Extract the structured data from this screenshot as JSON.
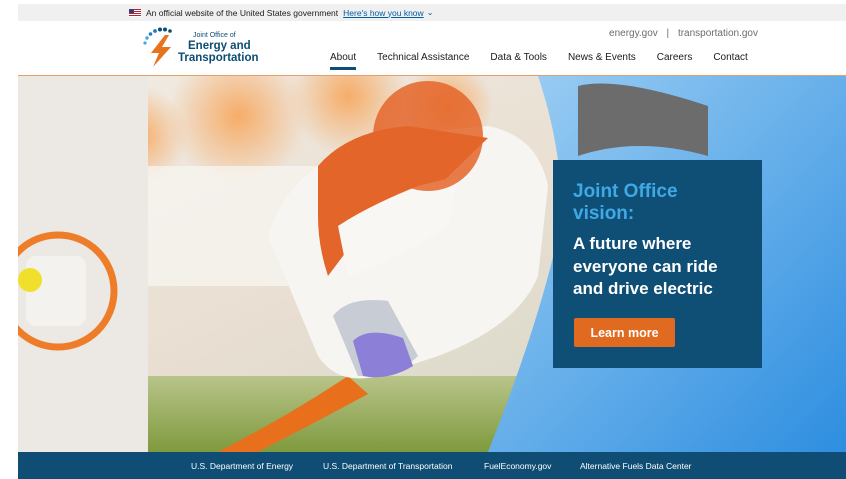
{
  "gov_banner": {
    "text": "An official website of the United States government",
    "link_text": "Here's how you know",
    "chevron_icon": "chevron-down-icon"
  },
  "logo": {
    "line1": "Joint Office of",
    "line2": "Energy and",
    "line3": "Transportation"
  },
  "utility_links": {
    "link1": "energy.gov",
    "separator": "|",
    "link2": "transportation.gov"
  },
  "nav": {
    "items": [
      "About",
      "Technical Assistance",
      "Data & Tools",
      "News & Events",
      "Careers",
      "Contact"
    ],
    "active": "About"
  },
  "hero": {
    "heading_line1": "Joint Office",
    "heading_line2": "vision:",
    "body_line1": "A future where",
    "body_line2": "everyone can ride",
    "body_line3": "and drive electric",
    "cta_label": "Learn more"
  },
  "footer": {
    "links": [
      "U.S. Department of Energy",
      "U.S. Department of Transportation",
      "FuelEconomy.gov",
      "Alternative Fuels Data Center"
    ]
  },
  "colors": {
    "brand_navy": "#0f4d74",
    "accent_orange": "#e16a21",
    "heading_blue": "#3fa9e6"
  }
}
